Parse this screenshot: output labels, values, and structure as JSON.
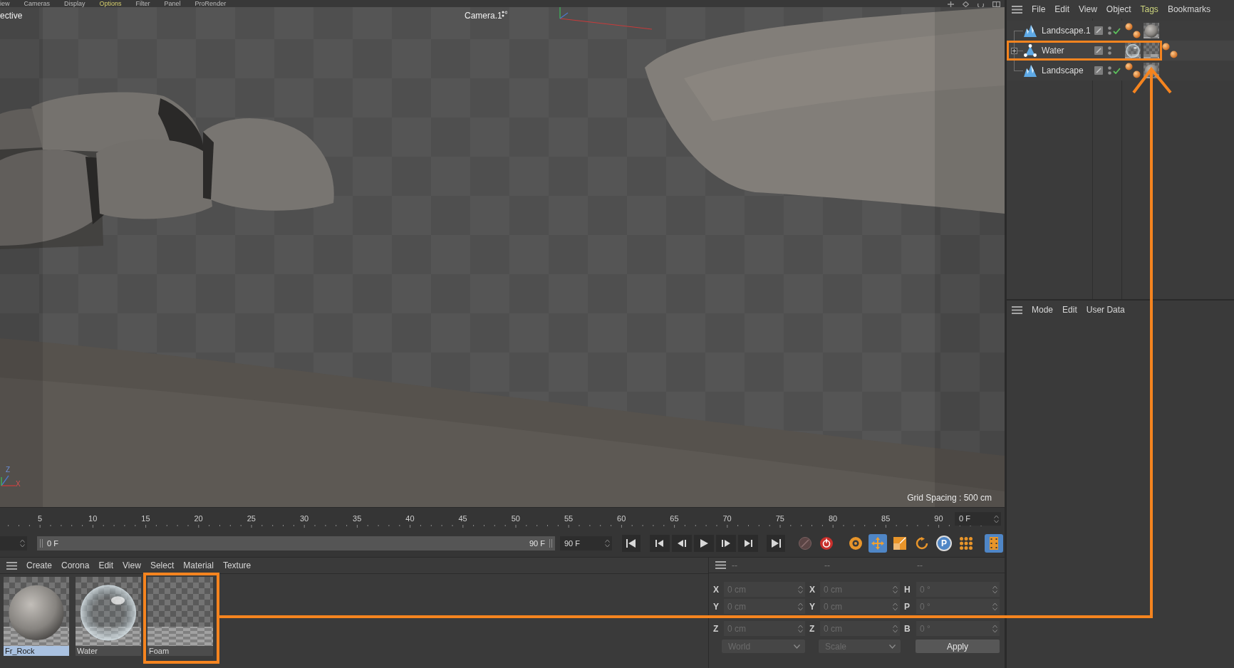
{
  "viewport": {
    "menu": [
      {
        "label": "iew",
        "highlighted": false
      },
      {
        "label": "Cameras",
        "highlighted": false
      },
      {
        "label": "Display",
        "highlighted": false
      },
      {
        "label": "Options",
        "highlighted": true
      },
      {
        "label": "Filter",
        "highlighted": false
      },
      {
        "label": "Panel",
        "highlighted": false
      },
      {
        "label": "ProRender",
        "highlighted": false
      }
    ],
    "view_name": "ective",
    "camera": "Camera.1",
    "axis_labels": [
      "Z",
      "X"
    ],
    "grid_spacing": "Grid Spacing : 500 cm"
  },
  "object_manager": {
    "menu": [
      {
        "label": "File",
        "highlighted": false
      },
      {
        "label": "Edit",
        "highlighted": false
      },
      {
        "label": "View",
        "highlighted": false
      },
      {
        "label": "Object",
        "highlighted": false
      },
      {
        "label": "Tags",
        "highlighted": true
      },
      {
        "label": "Bookmarks",
        "highlighted": false
      }
    ],
    "objects": [
      {
        "name": "Landscape.1",
        "kind": "landscape",
        "selected": false,
        "collapsed": false,
        "enabled": true,
        "callout": false,
        "tags": [
          {
            "kind": "phong",
            "callout": false
          },
          {
            "kind": "rock",
            "callout": false
          }
        ]
      },
      {
        "name": "Water",
        "kind": "polygon",
        "selected": false,
        "collapsed": true,
        "enabled": false,
        "callout": true,
        "tags": [
          {
            "kind": "water",
            "callout": false
          },
          {
            "kind": "foam",
            "callout": true
          },
          {
            "kind": "phong",
            "callout": false
          }
        ]
      },
      {
        "name": "Landscape",
        "kind": "landscape",
        "selected": false,
        "collapsed": false,
        "enabled": true,
        "callout": false,
        "tags": [
          {
            "kind": "phong",
            "callout": false
          },
          {
            "kind": "rock",
            "callout": false
          }
        ]
      }
    ]
  },
  "attributes": {
    "menu": [
      "Mode",
      "Edit",
      "User Data"
    ]
  },
  "timeline": {
    "ruler": [
      "5",
      "10",
      "15",
      "20",
      "25",
      "30",
      "35",
      "40",
      "45",
      "50",
      "55",
      "60",
      "65",
      "70",
      "75",
      "80",
      "85",
      "90"
    ],
    "current_frame": "0 F",
    "range_start": "0 F",
    "range_end": "90 F",
    "end_frame": "90 F",
    "transport": [
      {
        "kind": "start"
      },
      {
        "kind": "prevkey"
      },
      {
        "kind": "prevframe"
      },
      {
        "kind": "play"
      },
      {
        "kind": "nextframe"
      },
      {
        "kind": "nextkey"
      },
      {
        "kind": "end"
      }
    ],
    "tools": [
      {
        "kind": "record",
        "on": false
      },
      {
        "kind": "autokey",
        "on": false
      },
      {
        "kind": "keyframe",
        "on": false
      },
      {
        "kind": "move",
        "on": true
      },
      {
        "kind": "scale",
        "on": false
      },
      {
        "kind": "rotate",
        "on": false
      },
      {
        "kind": "param",
        "label": "P",
        "on": true
      },
      {
        "kind": "points",
        "on": false
      },
      {
        "kind": "film",
        "on": true
      }
    ]
  },
  "material_manager": {
    "menu": [
      "Create",
      "Corona",
      "Edit",
      "View",
      "Select",
      "Material",
      "Texture"
    ],
    "materials": [
      {
        "name": "Fr_Rock",
        "kind": "rock",
        "selected": true,
        "callout": false
      },
      {
        "name": "Water",
        "kind": "water",
        "selected": false,
        "callout": false
      },
      {
        "name": "Foam",
        "kind": "foam",
        "selected": false,
        "callout": true
      }
    ]
  },
  "coordinates": {
    "headers": [
      "--",
      "--",
      "--"
    ],
    "disabled": true,
    "rows": [
      [
        {
          "label": "X",
          "value": "0 cm"
        },
        {
          "label": "X",
          "value": "0 cm"
        },
        {
          "label": "H",
          "value": "0 °"
        }
      ],
      [
        {
          "label": "Y",
          "value": "0 cm"
        },
        {
          "label": "Y",
          "value": "0 cm"
        },
        {
          "label": "P",
          "value": "0 °"
        }
      ],
      [
        {
          "label": "Z",
          "value": "0 cm"
        },
        {
          "label": "Z",
          "value": "0 cm"
        },
        {
          "label": "B",
          "value": "0 °"
        }
      ]
    ],
    "dropdowns": [
      "World",
      "Scale"
    ],
    "apply": "Apply"
  }
}
